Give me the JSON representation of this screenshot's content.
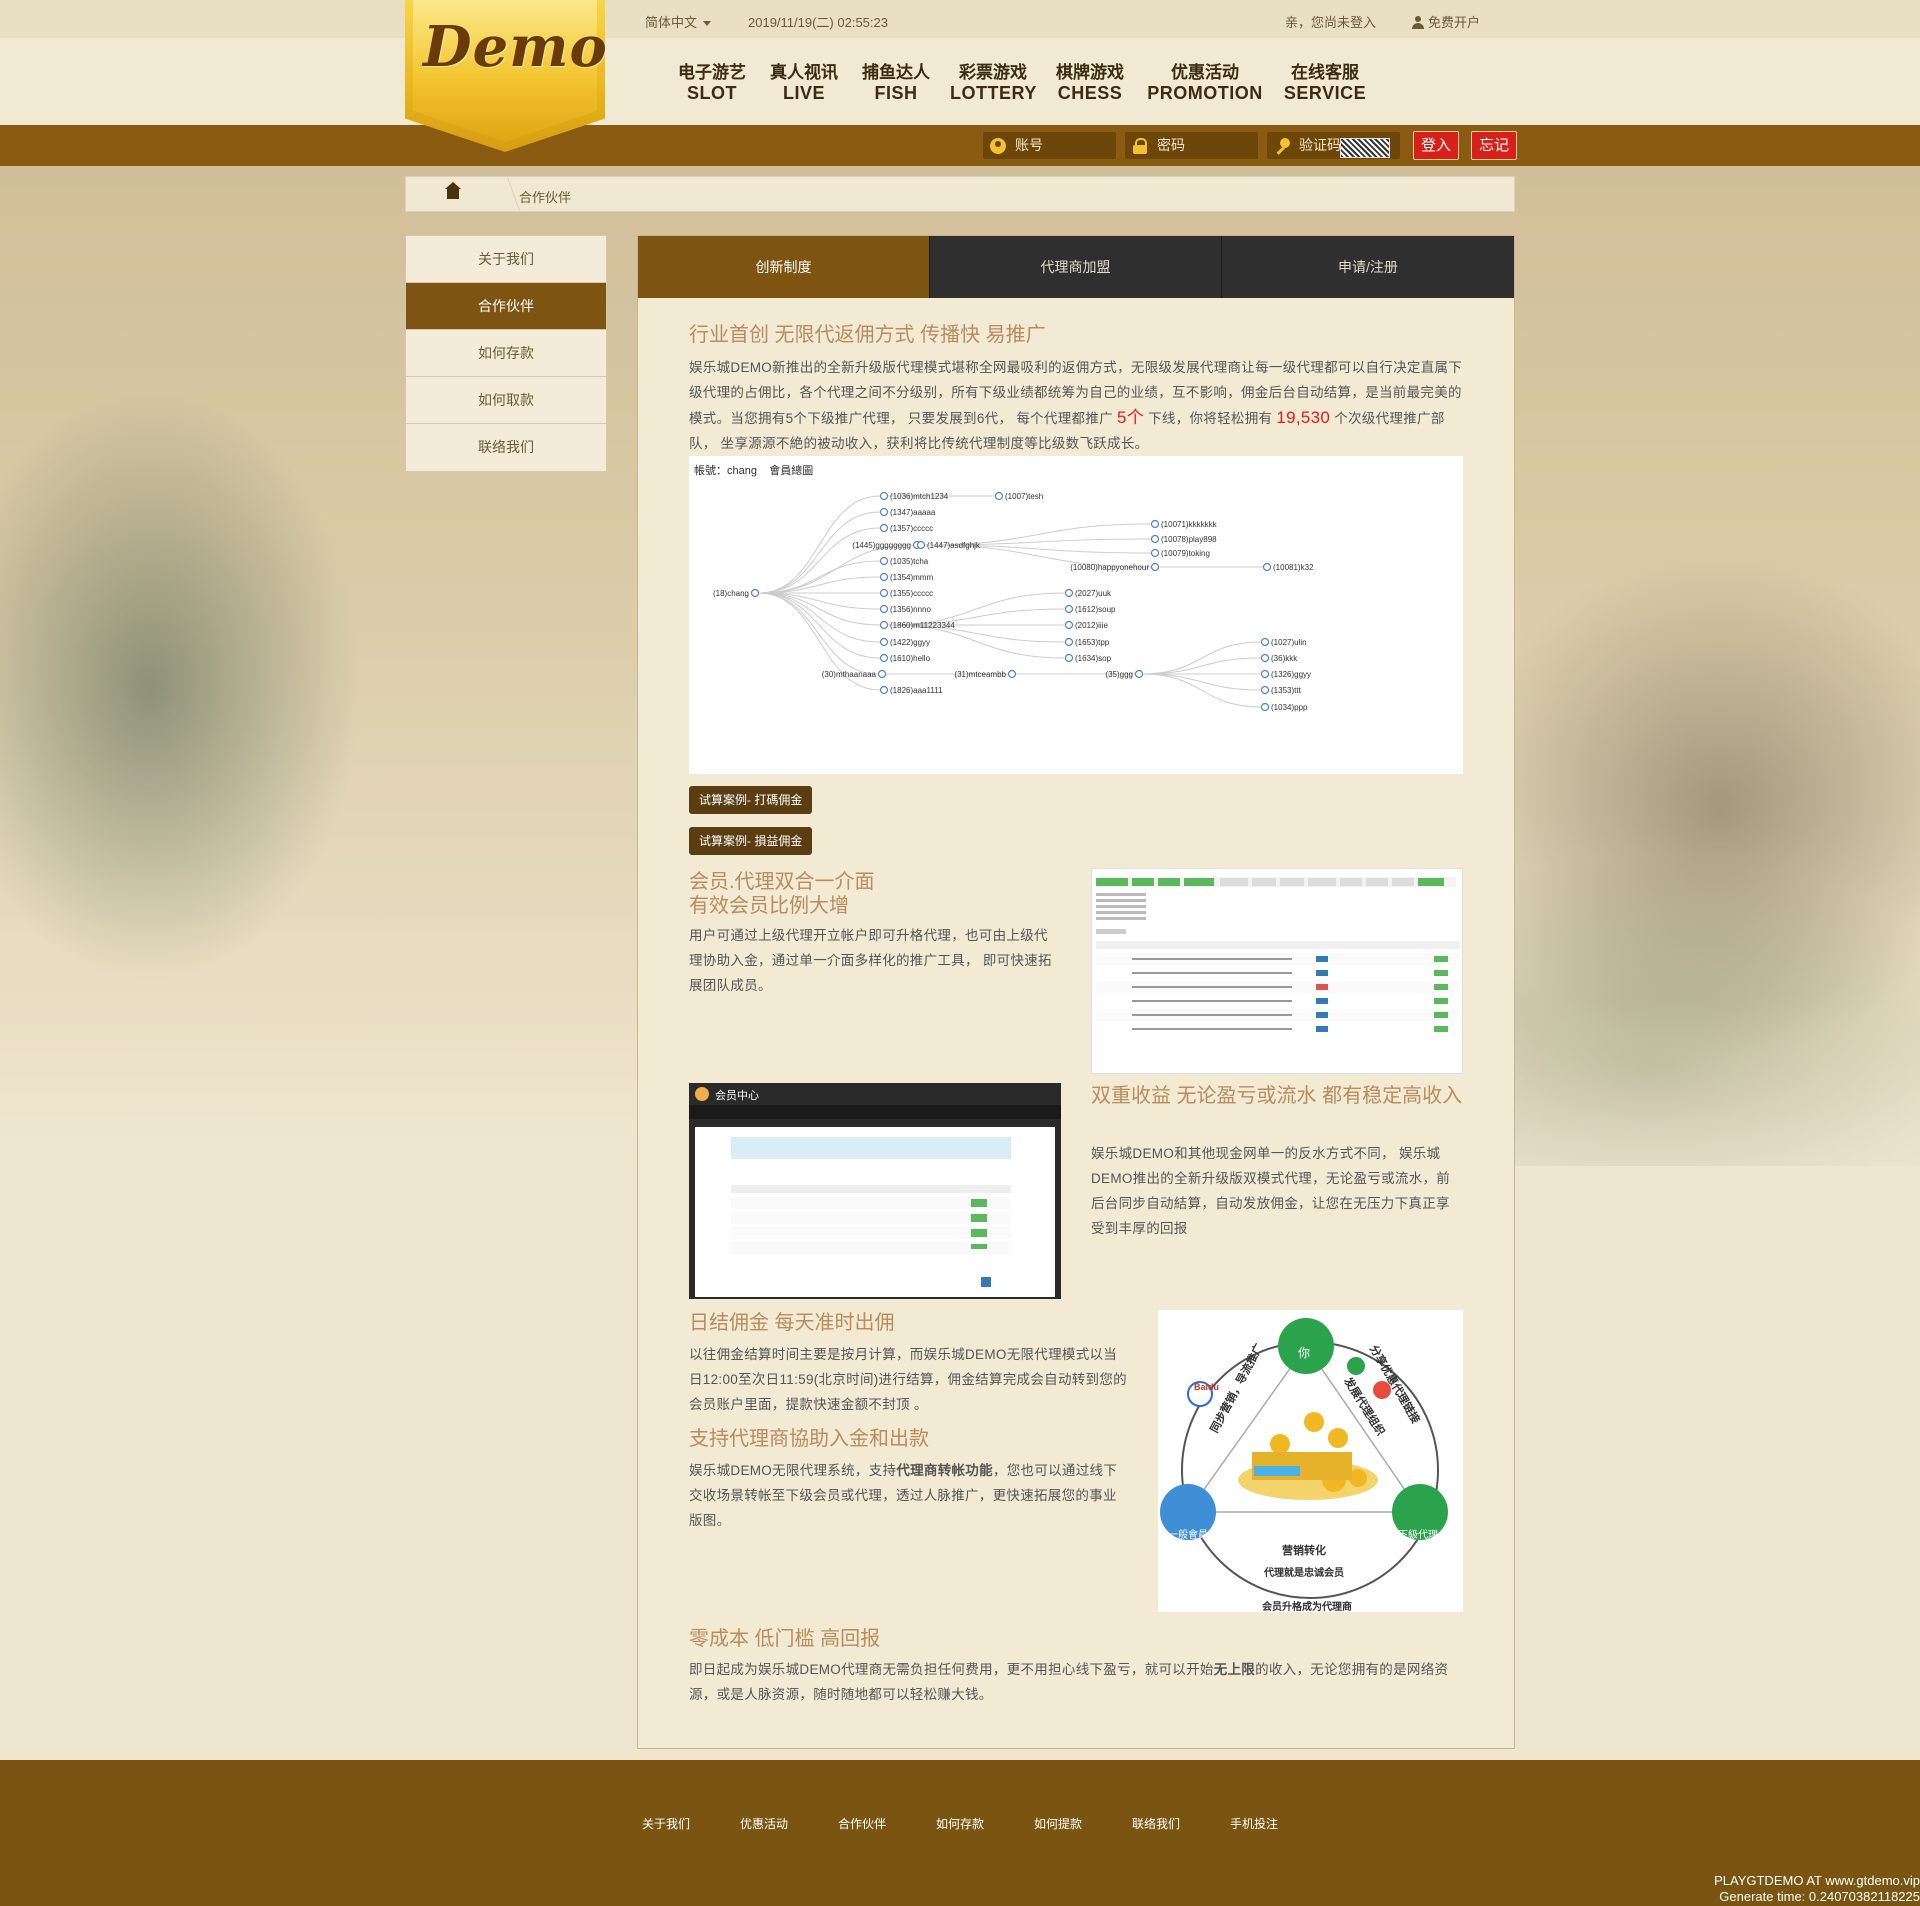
{
  "topbar": {
    "language": "简体中文",
    "datetime": "2019/11/19(二) 02:55:23",
    "greeting": "亲，您尚未登入",
    "register": "免费开户"
  },
  "logo": {
    "text": "Demo"
  },
  "nav": [
    {
      "cn": "电子游艺",
      "en": "SLOT"
    },
    {
      "cn": "真人视讯",
      "en": "LIVE"
    },
    {
      "cn": "捕鱼达人",
      "en": "FISH"
    },
    {
      "cn": "彩票游戏",
      "en": "LOTTERY"
    },
    {
      "cn": "棋牌游戏",
      "en": "CHESS"
    },
    {
      "cn": "优惠活动",
      "en": "PROMOTION"
    },
    {
      "cn": "在线客服",
      "en": "SERVICE"
    }
  ],
  "login": {
    "account_placeholder": "账号",
    "password_placeholder": "密码",
    "captcha_placeholder": "验证码",
    "login_label": "登入",
    "forgot_label": "忘记"
  },
  "breadcrumb": {
    "current": "合作伙伴"
  },
  "sidebar": {
    "items": [
      {
        "label": "关于我们"
      },
      {
        "label": "合作伙伴"
      },
      {
        "label": "如何存款"
      },
      {
        "label": "如何取款"
      },
      {
        "label": "联络我们"
      }
    ],
    "active_index": 1
  },
  "tabs": [
    {
      "label": "创新制度"
    },
    {
      "label": "代理商加盟"
    },
    {
      "label": "申请/注册"
    }
  ],
  "section1": {
    "title": "行业首创 无限代返佣方式 传播快 易推广",
    "text_a": "娱乐城DEMO新推出的全新升级版代理模式堪称全网最吸利的返佣方式，无限级发展代理商让每一级代理都可以自行决定直属下级代理的占佣比，各个代理之间不分级别，所有下级业绩都统筹为自己的业绩，互不影响，佣金后台自动结算，是当前最完美的模式。当您拥有5个下级推广代理， 只要发展到6代， 每个代理都推广",
    "highlight_a": "5个",
    "text_b": "下线，你将轻松拥有",
    "highlight_b": "19,530",
    "text_c": "个次级代理推广部队， 坐享源源不絶的被动收入，获利将比传统代理制度等比级数飞跃成长。"
  },
  "tree": {
    "header_account": "帳號：chang",
    "header_view": "會員總圖",
    "nodes": [
      "(18)chang",
      "(1445)gggggggg",
      "(30)mthaanaaa",
      "(1036)mtch1234",
      "(1347)aaaaa",
      "(1357)ccccc",
      "(1035)tcha",
      "(1354)mmm",
      "(1355)ccccc",
      "(1356)nnno",
      "(1860)m11223344",
      "(1422)ggyy",
      "(1610)hello",
      "(1826)aaa1111",
      "(1007)tesh",
      "(1447)asdfghjk",
      "(31)mtceambb",
      "(10071)kkkkkkk",
      "(10078)play898",
      "(10079)toking",
      "(10080)happyonehour",
      "(10081)k32",
      "(2027)uuk",
      "(1612)soup",
      "(2012)iiie",
      "(1653)tpp",
      "(1634)sop",
      "(35)ggg",
      "(1027)ulin",
      "(36)kkk",
      "(1326)ggyy",
      "(1353)ttt",
      "(1034)ppp"
    ]
  },
  "buttons": {
    "calc_bet": "试算案例- 打碼佣金",
    "calc_loss": "试算案例- 損益佣金"
  },
  "section2": {
    "title_line1": "会员.代理双合一介面",
    "title_line2": "有效会员比例大增",
    "text": "用户可通过上级代理开立帐户即可升格代理，也可由上级代理协助入金，通过单一介面多样化的推广工具， 即可快速拓展团队成员。"
  },
  "section3": {
    "title": "双重收益 无论盈亏或流水 都有稳定高收入",
    "text": "娱乐城DEMO和其他现金网单一的反水方式不同， 娱乐城DEMO推出的全新升级版双模式代理，无论盈亏或流水，前后台同步自动結算，自动发放佣金，让您在无压力下真正享受到丰厚的回报"
  },
  "member_center": {
    "title": "会员中心"
  },
  "section4": {
    "title": "日结佣金 每天准时出佣",
    "text": "以往佣金结算时间主要是按月计算，而娱乐城DEMO无限代理模式以当日12:00至次日11:59(北京时间)进行结算，佣金结算完成会自动转到您的会员账户里面，提款快速金额不封顶 。"
  },
  "section5": {
    "title": "支持代理商協助入金和出款",
    "text_a": "娱乐城DEMO无限代理系统，支持",
    "text_bold": "代理商转帐功能",
    "text_b": "，您也可以通过线下交收场景转帐至下级会员或代理，透过人脉推广，更快速拓展您的事业版图。"
  },
  "diagram": {
    "you": "你",
    "share": "分享优惠代理链接",
    "develop": "发展代理组织",
    "baidu": "Baidu",
    "sync": "同步营销，导流推广",
    "member": "一般會員",
    "sub_agent": "下級代理",
    "convert": "营销转化",
    "loyal": "代理就是忠诚会员",
    "upgrade": "会员升格成为代理商"
  },
  "section6": {
    "title": "零成本 低门槛 高回报",
    "text_a": "即日起成为娱乐城DEMO代理商无需负担任何费用，更不用担心线下盈亏，就可以开始",
    "text_bold": "无上限",
    "text_b": "的收入，无论您拥有的是网络资源，或是人脉资源，随时随地都可以轻松赚大钱。"
  },
  "footer": {
    "links": [
      "关于我们",
      "优惠活动",
      "合作伙伴",
      "如何存款",
      "如何提款",
      "联络我们",
      "手机投注"
    ],
    "credit_line1": "PLAYGTDEMO AT www.gtdemo.vip",
    "credit_line2": "Generate time: 0.24070382118225"
  },
  "colors": {
    "brand_brown": "#7e5411",
    "login_bar": "#8a5c12",
    "accent_red": "#d7201a",
    "heading": "#b78c5e",
    "tab_dark": "#2f2f2f"
  }
}
